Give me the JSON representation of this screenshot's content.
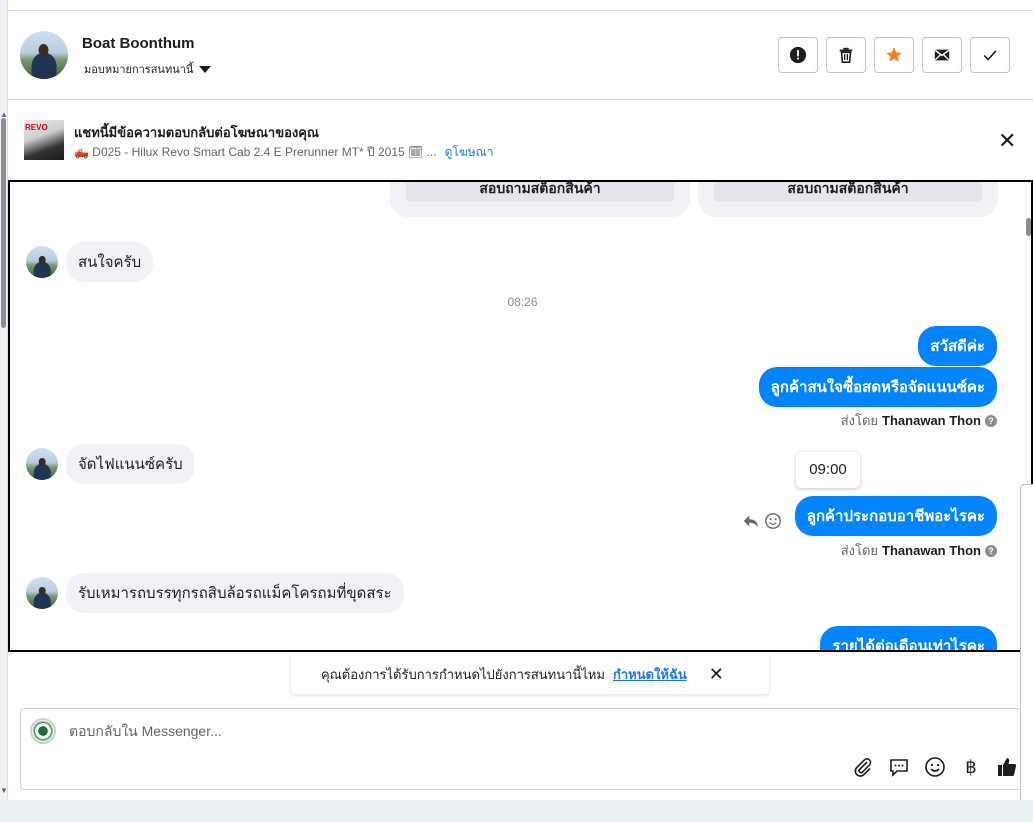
{
  "header": {
    "name": "Boat Boonthum",
    "assign_label": "มอบหมายการสนทนานี้",
    "actions": [
      "spam",
      "delete",
      "star",
      "mark-unread",
      "mark-done"
    ],
    "star_color": "#f5821f"
  },
  "ad": {
    "thumb_text": "REVO",
    "title": "แชทนี้มีข้อความตอบกลับต่อโฆษณาของคุณ",
    "subtitle": "🛻 D025 - Hilux Revo Smart Cab 2.4 E Prerunner MT* ปี 2015 🗓 ...",
    "link": "ดูโฆษณา"
  },
  "messages": {
    "card_buttons": [
      "สอบถามสต็อกสินค้า",
      "สอบถามสต็อกสินค้า"
    ],
    "incoming": [
      {
        "text": "สนใจครับ"
      },
      {
        "text": "จัดไฟแนนซ์ครับ"
      },
      {
        "text": "รับเหมารถบรรทุกรถสิบล้อรถแม็คโครถมที่ขุดสระ"
      }
    ],
    "timestamp": "08:26",
    "outgoing": [
      {
        "text": "สวัสดีค่ะ"
      },
      {
        "text": "ลูกค้าสนใจซื้อสดหรือจัดแนนซ์คะ"
      },
      {
        "text": "ลูกค้าประกอบอาชีพอะไรคะ"
      },
      {
        "text": "รายได้ต่อเดือนเท่าไรคะ"
      }
    ],
    "sent_by_prefix": "ส่งโดย",
    "sender": "Thanawan Thon",
    "tooltip_time": "09:00"
  },
  "assign_bar": {
    "text": "คุณต้องการได้รับการกำหนดไปยังการสนทนานี้ไหม",
    "link": "กำหนดให้ฉัน"
  },
  "composer": {
    "placeholder": "ตอบกลับใน Messenger...",
    "currency": "฿"
  },
  "colors": {
    "outgoing_bubble": "#0084ff",
    "incoming_bubble": "#f0f2f5",
    "link": "#1877f2"
  }
}
